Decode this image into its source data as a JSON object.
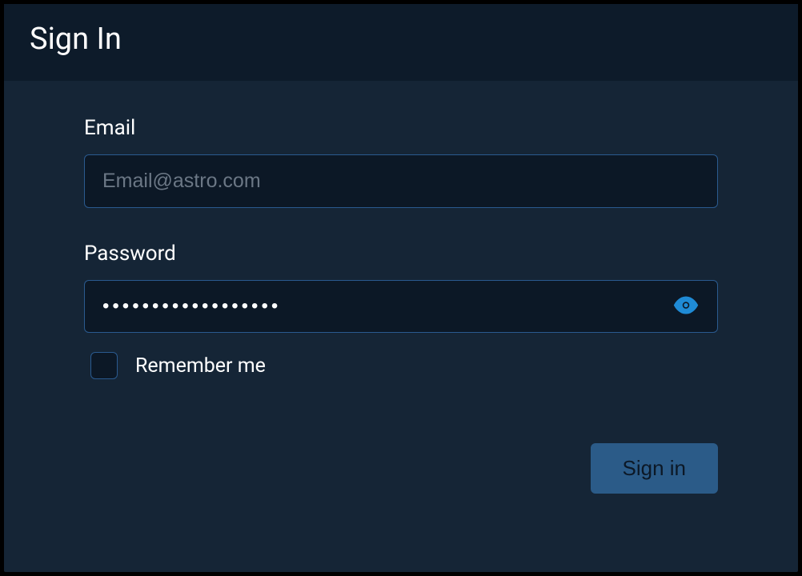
{
  "header": {
    "title": "Sign In"
  },
  "form": {
    "email": {
      "label": "Email",
      "placeholder": "Email@astro.com",
      "value": ""
    },
    "password": {
      "label": "Password",
      "value": "••••••••••••••••••"
    },
    "remember": {
      "label": "Remember me",
      "checked": false
    }
  },
  "footer": {
    "signin_label": "Sign in"
  }
}
